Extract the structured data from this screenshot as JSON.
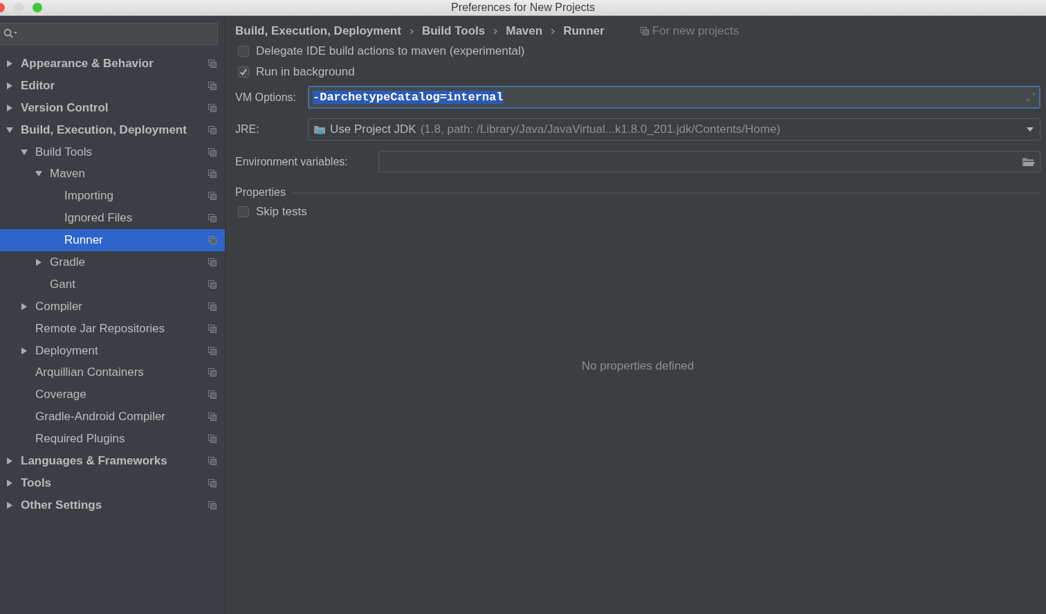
{
  "window": {
    "title": "Preferences for New Projects"
  },
  "tree": [
    {
      "label": "Appearance & Behavior",
      "expanded": false,
      "selected": false
    },
    {
      "label": "Editor",
      "expanded": false,
      "selected": false
    },
    {
      "label": "Version Control",
      "expanded": false,
      "selected": false
    },
    {
      "label": "Build, Execution, Deployment",
      "expanded": true,
      "selected": false,
      "children": [
        {
          "label": "Build Tools",
          "expanded": true,
          "selected": false,
          "children": [
            {
              "label": "Maven",
              "expanded": true,
              "selected": false,
              "children": [
                {
                  "label": "Importing",
                  "selected": false
                },
                {
                  "label": "Ignored Files",
                  "selected": false
                },
                {
                  "label": "Runner",
                  "selected": true
                }
              ]
            },
            {
              "label": "Gradle",
              "expanded": false,
              "selected": false
            },
            {
              "label": "Gant",
              "selected": false
            }
          ]
        },
        {
          "label": "Compiler",
          "expanded": false,
          "selected": false
        },
        {
          "label": "Remote Jar Repositories",
          "selected": false
        },
        {
          "label": "Deployment",
          "expanded": false,
          "selected": false
        },
        {
          "label": "Arquillian Containers",
          "selected": false
        },
        {
          "label": "Coverage",
          "selected": false
        },
        {
          "label": "Gradle-Android Compiler",
          "selected": false
        },
        {
          "label": "Required Plugins",
          "selected": false
        }
      ]
    },
    {
      "label": "Languages & Frameworks",
      "expanded": false,
      "selected": false
    },
    {
      "label": "Tools",
      "expanded": false,
      "selected": false
    },
    {
      "label": "Other Settings",
      "expanded": false,
      "selected": false
    }
  ],
  "breadcrumb": [
    "Build, Execution, Deployment",
    "Build Tools",
    "Maven",
    "Runner"
  ],
  "scope_note": "For new projects",
  "options": [
    {
      "label": "Delegate IDE build actions to maven (experimental)",
      "checked": false
    },
    {
      "label": "Run in background",
      "checked": true
    }
  ],
  "vm_options": {
    "label": "VM Options:",
    "value": "-DarchetypeCatalog=internal",
    "text_selected": true
  },
  "jre": {
    "label": "JRE:",
    "value": "Use Project JDK",
    "detail": "(1.8, path: /Library/Java/JavaVirtual...k1.8.0_201.jdk/Contents/Home)"
  },
  "environment": {
    "label": "Environment variables:"
  },
  "properties": {
    "title": "Properties",
    "skip_tests": {
      "label": "Skip tests",
      "checked": false
    },
    "empty_text": "No properties defined"
  }
}
